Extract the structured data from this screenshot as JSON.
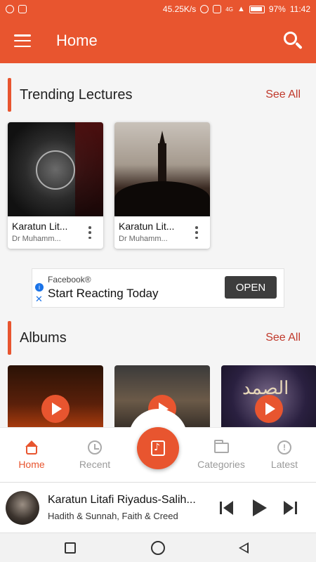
{
  "status_bar": {
    "network_speed": "45.25K/s",
    "network_type": "4G",
    "battery": "97%",
    "time": "11:42",
    "icons": [
      "whatsapp-icon",
      "screenshot-icon",
      "alarm-icon",
      "vibrate-icon",
      "signal-icon",
      "battery-icon"
    ]
  },
  "app_bar": {
    "title": "Home",
    "menu_icon": "hamburger-menu-icon",
    "search_icon": "search-icon",
    "color": "#e8552f"
  },
  "trending": {
    "title": "Trending Lectures",
    "see_all": "See All",
    "items": [
      {
        "title": "Karatun Lit...",
        "subtitle": "Dr Muhamm..."
      },
      {
        "title": "Karatun Lit...",
        "subtitle": "Dr Muhamm..."
      }
    ]
  },
  "ad": {
    "source": "Facebook®",
    "headline": "Start Reacting Today",
    "button": "OPEN",
    "info_icon": "i"
  },
  "albums": {
    "title": "Albums",
    "see_all": "See All",
    "items": [
      {
        "art_text": ""
      },
      {
        "art_text": ""
      },
      {
        "art_text": "الصمد"
      }
    ]
  },
  "bottom_nav": {
    "items": [
      {
        "label": "Home",
        "icon": "home-icon",
        "active": true
      },
      {
        "label": "Recent",
        "icon": "history-icon",
        "active": false
      },
      {
        "label": "Categories",
        "icon": "folder-icon",
        "active": false
      },
      {
        "label": "Latest",
        "icon": "badge-icon",
        "active": false
      }
    ],
    "center_icon": "music-library-icon"
  },
  "player": {
    "title": "Karatun Litafi Riyadus-Salih...",
    "subtitle": "Hadith & Sunnah, Faith & Creed"
  },
  "colors": {
    "accent": "#e8552f",
    "see_all": "#c0392b"
  }
}
